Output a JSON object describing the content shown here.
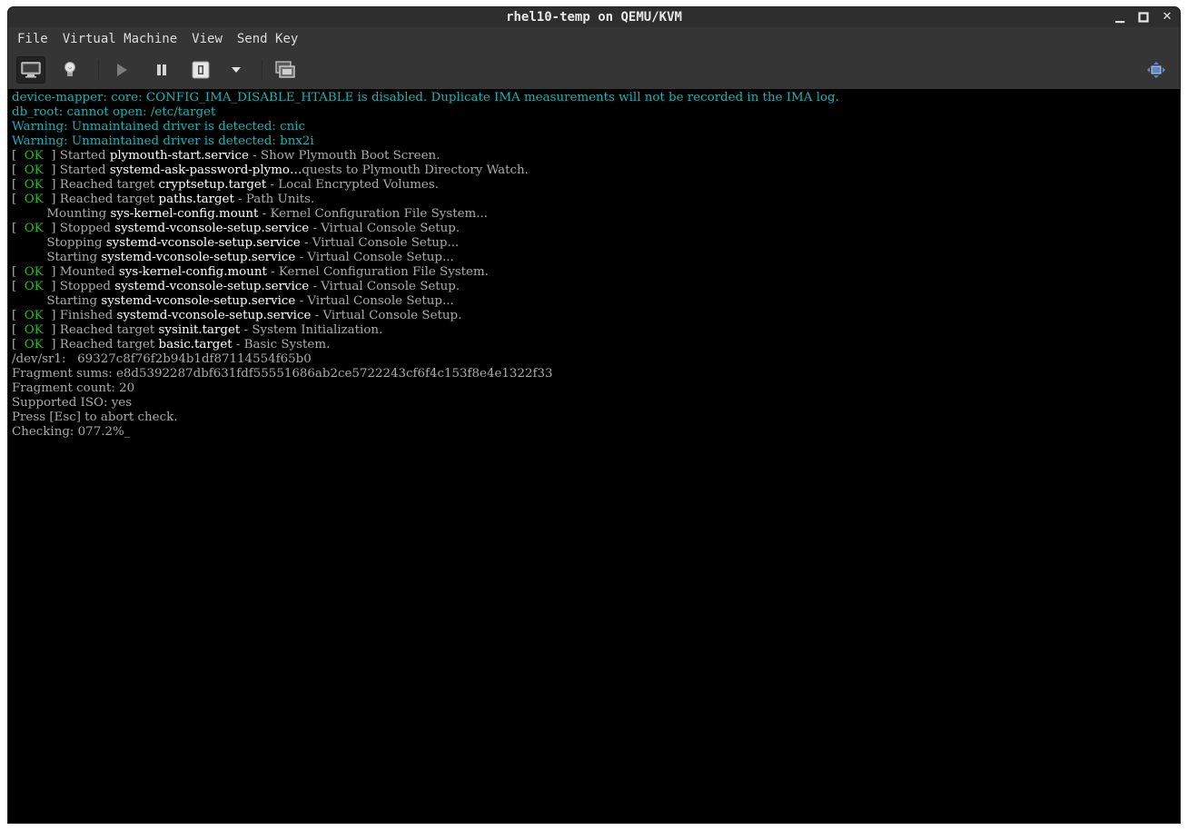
{
  "window": {
    "title": "rhel10-temp on QEMU/KVM",
    "minimize_glyph": "▁",
    "maximize_glyph": "■",
    "close_glyph": "✕"
  },
  "menu": {
    "file": "File",
    "virtual_machine": "Virtual Machine",
    "view": "View",
    "send_key": "Send Key"
  },
  "toolbar": {
    "icons": [
      "console-display-icon",
      "details-lightbulb-icon",
      "run-icon",
      "pause-icon",
      "shutdown-icon",
      "shutdown-menu-chevron-icon",
      "snapshots-icon",
      "resize-to-vm-icon"
    ]
  },
  "colors": {
    "console_bg": "#000000",
    "cyan": "#1ab2b2",
    "ok_green": "#28b628",
    "white": "#ffffff",
    "grey": "#aaaaaa"
  },
  "console": {
    "lines": [
      {
        "type": "cyan",
        "text": "device-mapper: core: CONFIG_IMA_DISABLE_HTABLE is disabled. Duplicate IMA measurements will not be recorded in the IMA log."
      },
      {
        "type": "cyan",
        "text": "db_root: cannot open: /etc/target"
      },
      {
        "type": "cyan",
        "text": "Warning: Unmaintained driver is detected: cnic"
      },
      {
        "type": "cyan",
        "text": "Warning: Unmaintained driver is detected: bnx2i"
      },
      {
        "type": "ok",
        "verb": "Started ",
        "unit": "plymouth-start.service",
        "desc": " - Show Plymouth Boot Screen."
      },
      {
        "type": "ok",
        "verb": "Started ",
        "unit": "systemd-ask-password-plymo…",
        "desc": "quests to Plymouth Directory Watch."
      },
      {
        "type": "ok",
        "verb": "Reached target ",
        "unit": "cryptsetup.target",
        "desc": " - Local Encrypted Volumes."
      },
      {
        "type": "ok",
        "verb": "Reached target ",
        "unit": "paths.target",
        "desc": " - Path Units."
      },
      {
        "type": "job",
        "verb": "Mounting ",
        "unit": "sys-kernel-config.mount",
        "desc": " - Kernel Configuration File System..."
      },
      {
        "type": "ok",
        "verb": "Stopped ",
        "unit": "systemd-vconsole-setup.service",
        "desc": " - Virtual Console Setup."
      },
      {
        "type": "job",
        "verb": "Stopping ",
        "unit": "systemd-vconsole-setup.service",
        "desc": " - Virtual Console Setup..."
      },
      {
        "type": "job",
        "verb": "Starting ",
        "unit": "systemd-vconsole-setup.service",
        "desc": " - Virtual Console Setup..."
      },
      {
        "type": "ok",
        "verb": "Mounted ",
        "unit": "sys-kernel-config.mount",
        "desc": " - Kernel Configuration File System."
      },
      {
        "type": "ok",
        "verb": "Stopped ",
        "unit": "systemd-vconsole-setup.service",
        "desc": " - Virtual Console Setup."
      },
      {
        "type": "job",
        "verb": "Starting ",
        "unit": "systemd-vconsole-setup.service",
        "desc": " - Virtual Console Setup..."
      },
      {
        "type": "ok",
        "verb": "Finished ",
        "unit": "systemd-vconsole-setup.service",
        "desc": " - Virtual Console Setup."
      },
      {
        "type": "ok",
        "verb": "Reached target ",
        "unit": "sysinit.target",
        "desc": " - System Initialization."
      },
      {
        "type": "ok",
        "verb": "Reached target ",
        "unit": "basic.target",
        "desc": " - Basic System."
      },
      {
        "type": "plain",
        "text": "/dev/sr1:   69327c8f76f2b94b1df87114554f65b0"
      },
      {
        "type": "plain",
        "text": "Fragment sums: e8d5392287dbf631fdf55551686ab2ce5722243cf6f4c153f8e4e1322f33"
      },
      {
        "type": "plain",
        "text": "Fragment count: 20"
      },
      {
        "type": "plain",
        "text": "Supported ISO: yes"
      },
      {
        "type": "plain",
        "text": "Press [Esc] to abort check."
      },
      {
        "type": "plain",
        "text": "Checking: 077.2%"
      }
    ],
    "ok_open": "[  ",
    "ok_label": "OK",
    "ok_close": "  ] ",
    "job_indent": "         ",
    "cursor": "_"
  }
}
